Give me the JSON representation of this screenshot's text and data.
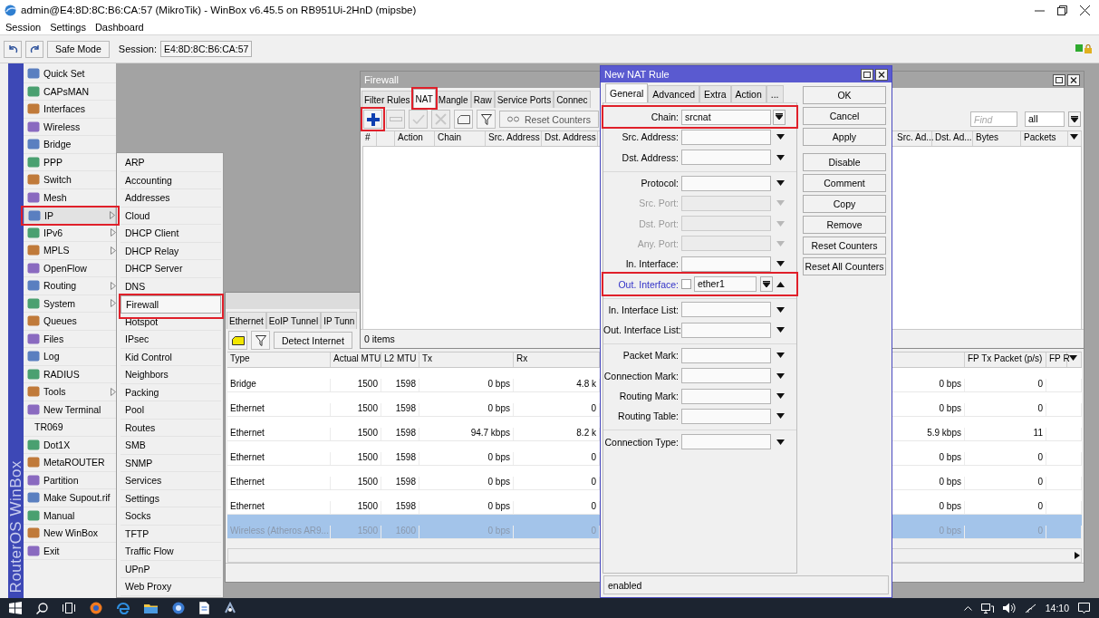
{
  "window": {
    "title": "admin@E4:8D:8C:B6:CA:57 (MikroTik) - WinBox v6.45.5 on RB951Ui-2HnD (mipsbe)"
  },
  "menu_bar": [
    "Session",
    "Settings",
    "Dashboard"
  ],
  "toolbar": {
    "safe_mode": "Safe Mode",
    "session_label": "Session:",
    "session_value": "E4:8D:8C:B6:CA:57"
  },
  "side_brand": "RouterOS WinBox",
  "sidebar": {
    "items": [
      {
        "label": "Quick Set",
        "icon": true,
        "has_submenu": false,
        "selected": false,
        "highlighted": false
      },
      {
        "label": "CAPsMAN",
        "icon": true,
        "has_submenu": false,
        "selected": false,
        "highlighted": false
      },
      {
        "label": "Interfaces",
        "icon": true,
        "has_submenu": false,
        "selected": false,
        "highlighted": false
      },
      {
        "label": "Wireless",
        "icon": true,
        "has_submenu": false,
        "selected": false,
        "highlighted": false
      },
      {
        "label": "Bridge",
        "icon": true,
        "has_submenu": false,
        "selected": false,
        "highlighted": false
      },
      {
        "label": "PPP",
        "icon": true,
        "has_submenu": false,
        "selected": false,
        "highlighted": false
      },
      {
        "label": "Switch",
        "icon": true,
        "has_submenu": false,
        "selected": false,
        "highlighted": false
      },
      {
        "label": "Mesh",
        "icon": true,
        "has_submenu": false,
        "selected": false,
        "highlighted": false
      },
      {
        "label": "IP",
        "icon": true,
        "has_submenu": true,
        "selected": true,
        "highlighted": true
      },
      {
        "label": "IPv6",
        "icon": true,
        "has_submenu": true,
        "selected": false,
        "highlighted": false
      },
      {
        "label": "MPLS",
        "icon": true,
        "has_submenu": true,
        "selected": false,
        "highlighted": false
      },
      {
        "label": "OpenFlow",
        "icon": true,
        "has_submenu": false,
        "selected": false,
        "highlighted": false
      },
      {
        "label": "Routing",
        "icon": true,
        "has_submenu": true,
        "selected": false,
        "highlighted": false
      },
      {
        "label": "System",
        "icon": true,
        "has_submenu": true,
        "selected": false,
        "highlighted": false
      },
      {
        "label": "Queues",
        "icon": true,
        "has_submenu": false,
        "selected": false,
        "highlighted": false
      },
      {
        "label": "Files",
        "icon": true,
        "has_submenu": false,
        "selected": false,
        "highlighted": false
      },
      {
        "label": "Log",
        "icon": true,
        "has_submenu": false,
        "selected": false,
        "highlighted": false
      },
      {
        "label": "RADIUS",
        "icon": true,
        "has_submenu": false,
        "selected": false,
        "highlighted": false
      },
      {
        "label": "Tools",
        "icon": true,
        "has_submenu": true,
        "selected": false,
        "highlighted": false
      },
      {
        "label": "New Terminal",
        "icon": true,
        "has_submenu": false,
        "selected": false,
        "highlighted": false
      },
      {
        "label": "TR069",
        "icon": false,
        "has_submenu": false,
        "selected": false,
        "highlighted": false
      },
      {
        "label": "Dot1X",
        "icon": true,
        "has_submenu": false,
        "selected": false,
        "highlighted": false
      },
      {
        "label": "MetaROUTER",
        "icon": true,
        "has_submenu": false,
        "selected": false,
        "highlighted": false
      },
      {
        "label": "Partition",
        "icon": true,
        "has_submenu": false,
        "selected": false,
        "highlighted": false
      },
      {
        "label": "Make Supout.rif",
        "icon": true,
        "has_submenu": false,
        "selected": false,
        "highlighted": false
      },
      {
        "label": "Manual",
        "icon": true,
        "has_submenu": false,
        "selected": false,
        "highlighted": false
      },
      {
        "label": "New WinBox",
        "icon": true,
        "has_submenu": false,
        "selected": false,
        "highlighted": false
      },
      {
        "label": "Exit",
        "icon": true,
        "has_submenu": false,
        "selected": false,
        "highlighted": false
      }
    ]
  },
  "submenu": {
    "items": [
      {
        "label": "ARP",
        "selected": false,
        "highlighted": false
      },
      {
        "label": "Accounting",
        "selected": false,
        "highlighted": false
      },
      {
        "label": "Addresses",
        "selected": false,
        "highlighted": false
      },
      {
        "label": "Cloud",
        "selected": false,
        "highlighted": false
      },
      {
        "label": "DHCP Client",
        "selected": false,
        "highlighted": false
      },
      {
        "label": "DHCP Relay",
        "selected": false,
        "highlighted": false
      },
      {
        "label": "DHCP Server",
        "selected": false,
        "highlighted": false
      },
      {
        "label": "DNS",
        "selected": false,
        "highlighted": false
      },
      {
        "label": "Firewall",
        "selected": true,
        "highlighted": true
      },
      {
        "label": "Hotspot",
        "selected": false,
        "highlighted": false
      },
      {
        "label": "IPsec",
        "selected": false,
        "highlighted": false
      },
      {
        "label": "Kid Control",
        "selected": false,
        "highlighted": false
      },
      {
        "label": "Neighbors",
        "selected": false,
        "highlighted": false
      },
      {
        "label": "Packing",
        "selected": false,
        "highlighted": false
      },
      {
        "label": "Pool",
        "selected": false,
        "highlighted": false
      },
      {
        "label": "Routes",
        "selected": false,
        "highlighted": false
      },
      {
        "label": "SMB",
        "selected": false,
        "highlighted": false
      },
      {
        "label": "SNMP",
        "selected": false,
        "highlighted": false
      },
      {
        "label": "Services",
        "selected": false,
        "highlighted": false
      },
      {
        "label": "Settings",
        "selected": false,
        "highlighted": false
      },
      {
        "label": "Socks",
        "selected": false,
        "highlighted": false
      },
      {
        "label": "TFTP",
        "selected": false,
        "highlighted": false
      },
      {
        "label": "Traffic Flow",
        "selected": false,
        "highlighted": false
      },
      {
        "label": "UPnP",
        "selected": false,
        "highlighted": false
      },
      {
        "label": "Web Proxy",
        "selected": false,
        "highlighted": false
      }
    ]
  },
  "interfaces_window": {
    "tabs": [
      {
        "label": "Ethernet",
        "selected": false
      },
      {
        "label": "EoIP Tunnel",
        "selected": false
      },
      {
        "label": "IP Tunn",
        "selected": false
      }
    ],
    "detect_internet": "Detect Internet",
    "columns": [
      "Type",
      "Actual MTU",
      "L2 MTU",
      "Tx",
      "Rx"
    ],
    "right_columns": [
      "FP Tx Packet (p/s)",
      "FP R"
    ],
    "rows": [
      {
        "type": "Bridge",
        "actual_mtu": "1500",
        "l2_mtu": "1598",
        "tx": "0 bps",
        "rx": "4.8 k",
        "column_6": "0 bps",
        "fp_tx": "0",
        "selected": false,
        "disabled": false
      },
      {
        "type": "Ethernet",
        "actual_mtu": "1500",
        "l2_mtu": "1598",
        "tx": "0 bps",
        "rx": "0",
        "column_6": "0 bps",
        "fp_tx": "0",
        "selected": false,
        "disabled": false
      },
      {
        "type": "Ethernet",
        "actual_mtu": "1500",
        "l2_mtu": "1598",
        "tx": "94.7 kbps",
        "rx": "8.2 k",
        "column_6": "5.9 kbps",
        "fp_tx": "11",
        "selected": false,
        "disabled": false
      },
      {
        "type": "Ethernet",
        "actual_mtu": "1500",
        "l2_mtu": "1598",
        "tx": "0 bps",
        "rx": "0",
        "column_6": "0 bps",
        "fp_tx": "0",
        "selected": false,
        "disabled": false
      },
      {
        "type": "Ethernet",
        "actual_mtu": "1500",
        "l2_mtu": "1598",
        "tx": "0 bps",
        "rx": "0",
        "column_6": "0 bps",
        "fp_tx": "0",
        "selected": false,
        "disabled": false
      },
      {
        "type": "Ethernet",
        "actual_mtu": "1500",
        "l2_mtu": "1598",
        "tx": "0 bps",
        "rx": "0",
        "column_6": "0 bps",
        "fp_tx": "0",
        "selected": false,
        "disabled": false
      },
      {
        "type": "Wireless (Atheros AR9...",
        "actual_mtu": "1500",
        "l2_mtu": "1600",
        "tx": "0 bps",
        "rx": "0",
        "column_6": "0 bps",
        "fp_tx": "0",
        "selected": true,
        "disabled": true
      }
    ]
  },
  "firewall_window": {
    "title": "Firewall",
    "tabs": [
      {
        "label": "Filter Rules",
        "selected": false,
        "highlighted": false
      },
      {
        "label": "NAT",
        "selected": true,
        "highlighted": true
      },
      {
        "label": "Mangle",
        "selected": false,
        "highlighted": false
      },
      {
        "label": "Raw",
        "selected": false,
        "highlighted": false
      },
      {
        "label": "Service Ports",
        "selected": false,
        "highlighted": false
      },
      {
        "label": "Connec",
        "selected": false,
        "highlighted": false
      }
    ],
    "tools": [
      {
        "kind": "add",
        "disabled": false,
        "highlighted": true
      },
      {
        "kind": "remove",
        "disabled": true,
        "highlighted": false
      },
      {
        "kind": "enable",
        "disabled": true,
        "highlighted": false
      },
      {
        "kind": "disable",
        "disabled": true,
        "highlighted": false
      },
      {
        "kind": "comment",
        "disabled": false,
        "highlighted": false
      },
      {
        "kind": "filter",
        "disabled": false,
        "highlighted": false
      }
    ],
    "reset_counters": "Reset Counters",
    "find": {
      "placeholder": "Find"
    },
    "filter_value": "all",
    "columns": [
      "#",
      "Action",
      "Chain",
      "Src. Address",
      "Dst. Address"
    ],
    "right_columns": [
      "Src. Ad...",
      "Dst. Ad...",
      "Bytes",
      "Packets"
    ],
    "status": "0 items"
  },
  "nat_rule_dialog": {
    "title": "New NAT Rule",
    "tabs": [
      {
        "label": "General",
        "selected": true
      },
      {
        "label": "Advanced",
        "selected": false
      },
      {
        "label": "Extra",
        "selected": false
      },
      {
        "label": "Action",
        "selected": false
      },
      {
        "label": "...",
        "selected": false
      }
    ],
    "groups": [
      {
        "fields": [
          {
            "label": "Chain:",
            "kind": "combo",
            "value": "srcnat",
            "disabled": false,
            "active": false,
            "highlighted": true
          },
          {
            "label": "Src. Address:",
            "kind": "dropdown",
            "disabled": false,
            "active": false,
            "highlighted": false
          },
          {
            "label": "Dst. Address:",
            "kind": "dropdown",
            "disabled": false,
            "active": false,
            "highlighted": false
          }
        ]
      },
      {
        "fields": [
          {
            "label": "Protocol:",
            "kind": "dropdown",
            "disabled": false,
            "active": false,
            "highlighted": false
          },
          {
            "label": "Src. Port:",
            "kind": "dropdown",
            "disabled": true,
            "active": false,
            "highlighted": false
          },
          {
            "label": "Dst. Port:",
            "kind": "dropdown",
            "disabled": true,
            "active": false,
            "highlighted": false
          },
          {
            "label": "Any. Port:",
            "kind": "dropdown",
            "disabled": true,
            "active": false,
            "highlighted": false
          },
          {
            "label": "In. Interface:",
            "kind": "dropdown",
            "disabled": false,
            "active": false,
            "highlighted": false
          },
          {
            "label": "Out. Interface:",
            "kind": "interface",
            "value": "ether1",
            "checked": false,
            "disabled": false,
            "active": true,
            "highlighted": true
          }
        ]
      },
      {
        "fields": [
          {
            "label": "In. Interface List:",
            "kind": "dropdown",
            "disabled": false,
            "active": false,
            "highlighted": false
          },
          {
            "label": "Out. Interface List:",
            "kind": "dropdown",
            "disabled": false,
            "active": false,
            "highlighted": false
          }
        ]
      },
      {
        "fields": [
          {
            "label": "Packet Mark:",
            "kind": "dropdown",
            "disabled": false,
            "active": false,
            "highlighted": false
          },
          {
            "label": "Connection Mark:",
            "kind": "dropdown",
            "disabled": false,
            "active": false,
            "highlighted": false
          },
          {
            "label": "Routing Mark:",
            "kind": "dropdown",
            "disabled": false,
            "active": false,
            "highlighted": false
          },
          {
            "label": "Routing Table:",
            "kind": "dropdown",
            "disabled": false,
            "active": false,
            "highlighted": false
          }
        ]
      },
      {
        "fields": [
          {
            "label": "Connection Type:",
            "kind": "dropdown",
            "disabled": false,
            "active": false,
            "highlighted": false
          }
        ]
      }
    ],
    "button_groups": [
      [
        "OK",
        "Cancel",
        "Apply"
      ],
      [
        "Disable",
        "Comment",
        "Copy",
        "Remove",
        "Reset Counters",
        "Reset All Counters"
      ]
    ],
    "status": "enabled"
  },
  "taskbar": {
    "time": "14:10"
  }
}
